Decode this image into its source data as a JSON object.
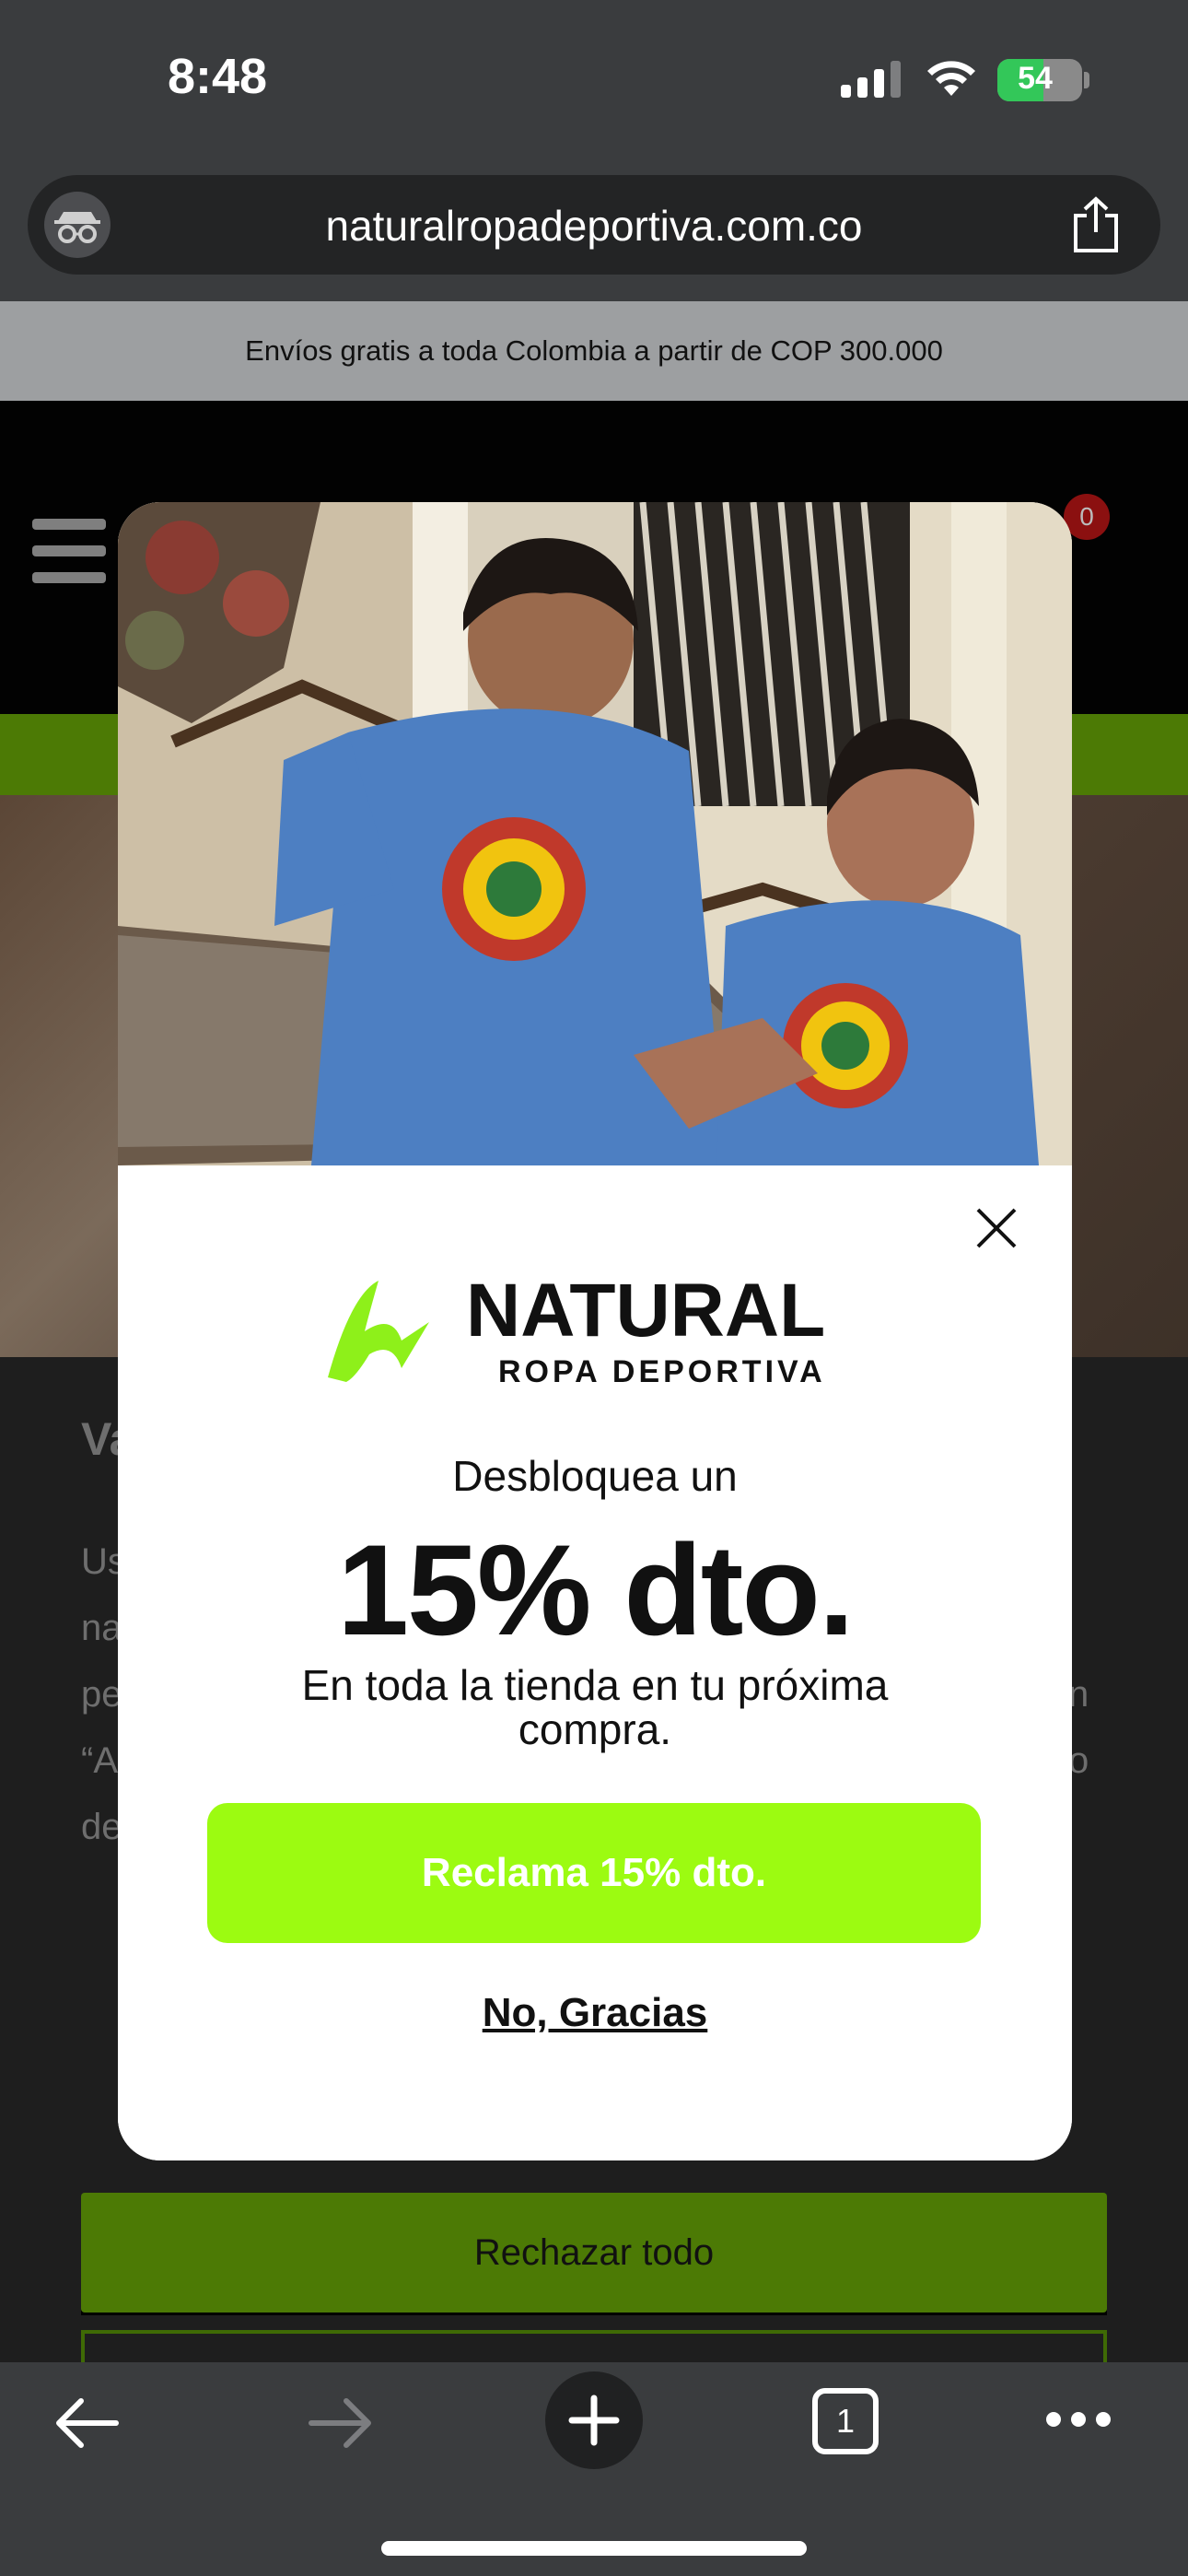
{
  "status_bar": {
    "time": "8:48",
    "battery_percent": "54",
    "battery_level": 0.54
  },
  "browser": {
    "url": "naturalropadeportiva.com.co",
    "open_tabs": "1"
  },
  "page": {
    "promo_text": "Envíos gratis a toda Colombia a partir de COP 300.000",
    "cart_count": "0",
    "reject_all_label": "Rechazar todo"
  },
  "modal": {
    "logo_name": "NATURAL",
    "logo_tagline": "ROPA DEPORTIVA",
    "unlock_text": "Desbloquea un",
    "discount_text": "15% dto.",
    "subtext": "En toda la tienda en tu próxima compra.",
    "claim_label": "Reclama 15% dto.",
    "decline_label": "No, Gracias"
  },
  "colors": {
    "brand_green": "#9cfb11",
    "dark_green": "#4c7a05",
    "jersey_blue": "#4d7fc2"
  },
  "icons": [
    "incognito-icon",
    "share-icon",
    "close-icon",
    "hamburger-menu-icon",
    "back-arrow-icon",
    "forward-arrow-icon",
    "plus-icon",
    "tabs-icon",
    "more-icon"
  ]
}
